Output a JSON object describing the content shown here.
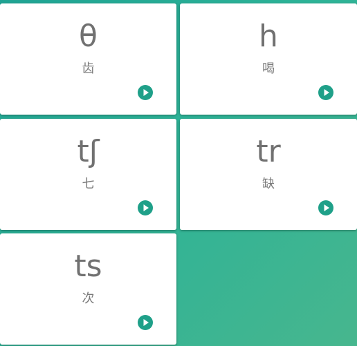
{
  "theme": {
    "accent": "#1fa089",
    "background_start": "#1fa393",
    "background_end": "#47b68e",
    "text": "#717171"
  },
  "cards": [
    {
      "symbol": "θ",
      "word": "齿",
      "action_icon": "play-icon"
    },
    {
      "symbol": "h",
      "word": "喝",
      "action_icon": "play-icon"
    },
    {
      "symbol": "tʃ",
      "word": "七",
      "action_icon": "play-icon"
    },
    {
      "symbol": "tr",
      "word": "缺",
      "action_icon": "play-icon"
    },
    {
      "symbol": "ts",
      "word": "次",
      "action_icon": "play-icon"
    }
  ]
}
